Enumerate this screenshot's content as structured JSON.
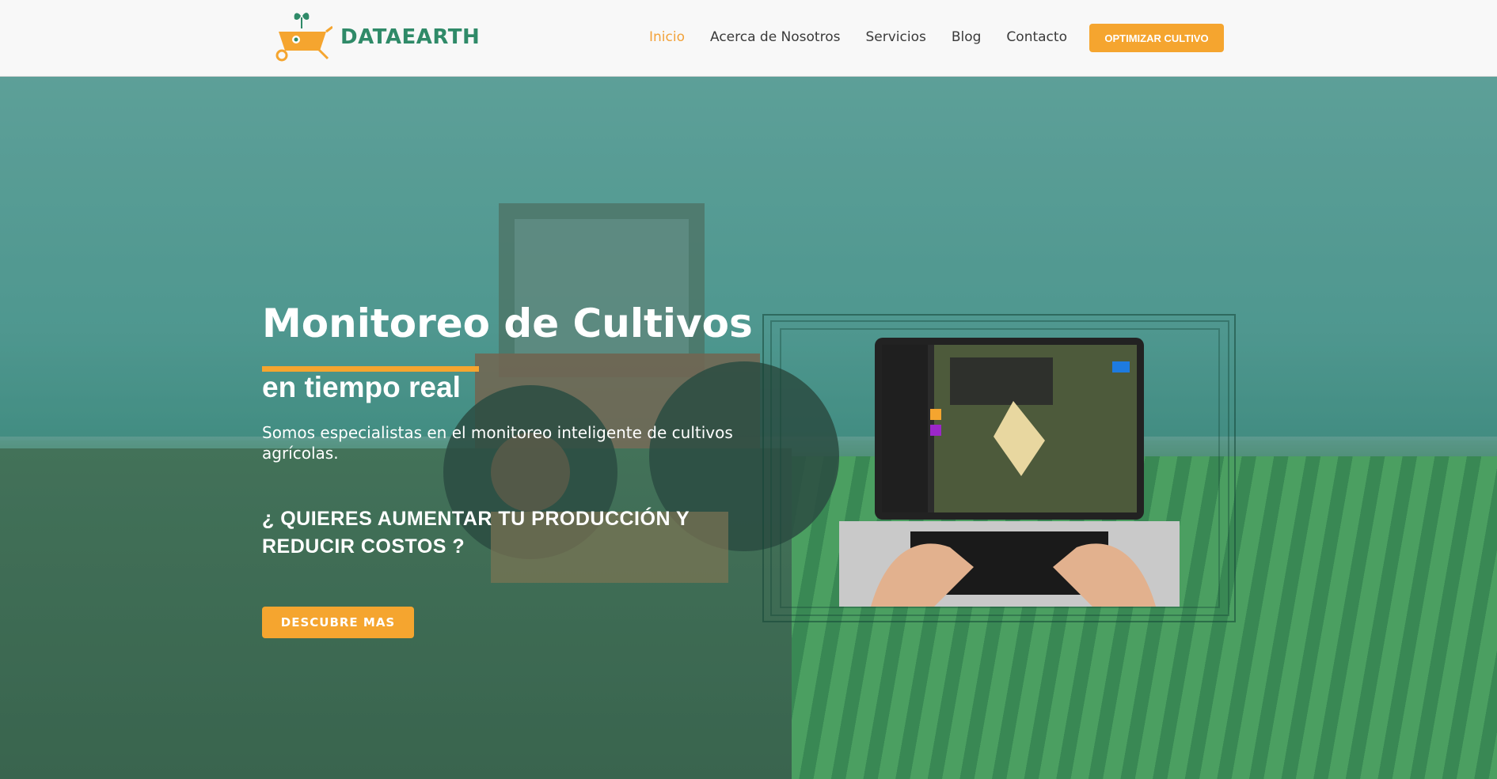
{
  "brand": {
    "name": "DATAEARTH"
  },
  "nav": {
    "items": [
      {
        "label": "Inicio",
        "active": true
      },
      {
        "label": "Acerca de Nosotros",
        "active": false
      },
      {
        "label": "Servicios",
        "active": false
      },
      {
        "label": "Blog",
        "active": false
      },
      {
        "label": "Contacto",
        "active": false
      }
    ],
    "cta_label": "OPTIMIZAR CULTIVO"
  },
  "hero": {
    "title": "Monitoreo de Cultivos",
    "subtitle": "en tiempo real",
    "description": "Somos especialistas en el monitoreo inteligente de cultivos agrícolas.",
    "question": "¿ QUIERES AUMENTAR TU PRODUCCIÓN Y REDUCIR COSTOS ?",
    "button_label": "DESCUBRE MAS"
  },
  "colors": {
    "accent": "#f5a52f",
    "brand": "#2f8a68",
    "nav_text": "#3a3a3a"
  },
  "icons": {
    "logo": "wheelbarrow-sprout-icon"
  }
}
